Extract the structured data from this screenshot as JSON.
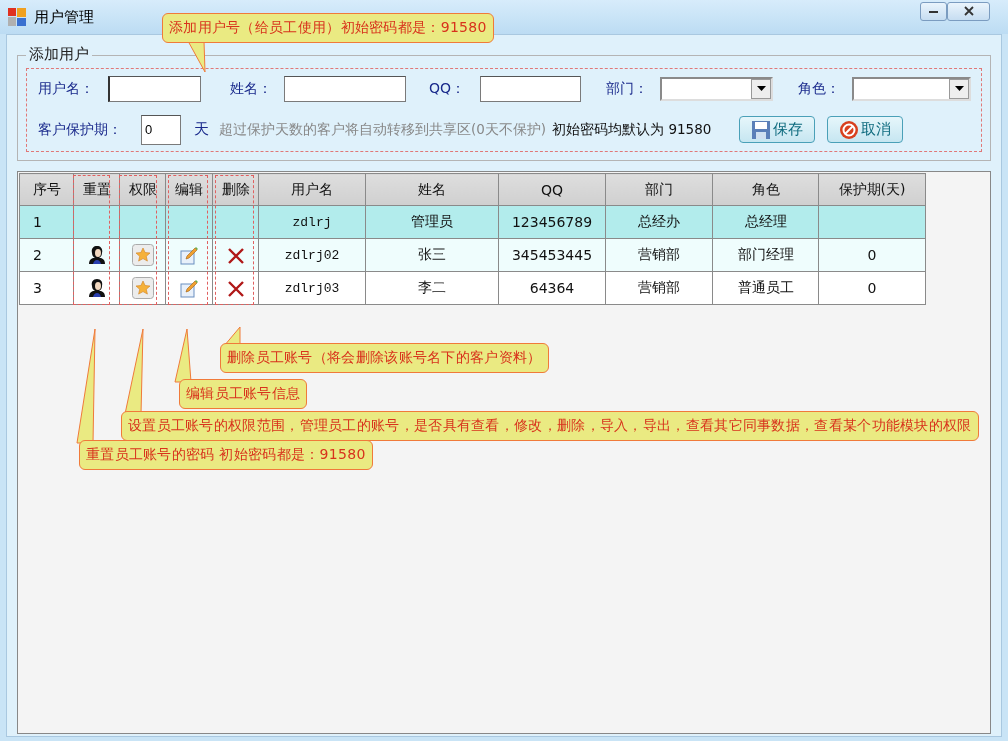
{
  "window": {
    "title": "用户管理"
  },
  "form": {
    "title": "添加用户",
    "fields": [
      {
        "kind": "text",
        "label": "用户名：",
        "focused": true
      },
      {
        "kind": "text",
        "label": "姓名：",
        "focused": false
      },
      {
        "kind": "text",
        "label": "QQ：",
        "focused": false
      },
      {
        "kind": "select",
        "label": "部门："
      },
      {
        "kind": "select",
        "label": "角色："
      }
    ],
    "protection": {
      "label": "客户保护期：",
      "value": "0",
      "unit": "天"
    },
    "hint": "超过保护天数的客户将自动转移到共享区(0天不保护)",
    "note": "初始密码均默认为 91580",
    "buttons": [
      {
        "kind": "save",
        "label": "保存"
      },
      {
        "kind": "cancel",
        "label": "取消"
      }
    ]
  },
  "table": {
    "columns": [
      "序号",
      "重置",
      "权限",
      "编辑",
      "删除",
      "用户名",
      "姓名",
      "QQ",
      "部门",
      "角色",
      "保护期(天)"
    ],
    "rows": [
      {
        "selected": true,
        "actions": false,
        "cells": [
          "1",
          "",
          "",
          "",
          "",
          "zdlrj",
          "管理员",
          "123456789",
          "总经办",
          "总经理",
          ""
        ]
      },
      {
        "selected": false,
        "actions": true,
        "cells": [
          "2",
          "",
          "",
          "",
          "",
          "zdlrj02",
          "张三",
          "345453445",
          "营销部",
          "部门经理",
          "0"
        ]
      },
      {
        "selected": false,
        "actions": true,
        "cells": [
          "3",
          "",
          "",
          "",
          "",
          "zdlrj03",
          "李二",
          "64364",
          "营销部",
          "普通员工",
          "0"
        ]
      }
    ]
  },
  "callouts": [
    "添加用户号（给员工使用）初始密码都是：91580",
    "删除员工账号（将会删除该账号名下的客户资料）",
    "编辑员工账号信息",
    "设置员工账号的权限范围，管理员工的账号，是否具有查看，修改，删除，导入，导出，查看其它同事数据，查看某个功能模块的权限",
    "重置员工账号的密码 初始密码都是：91580"
  ]
}
